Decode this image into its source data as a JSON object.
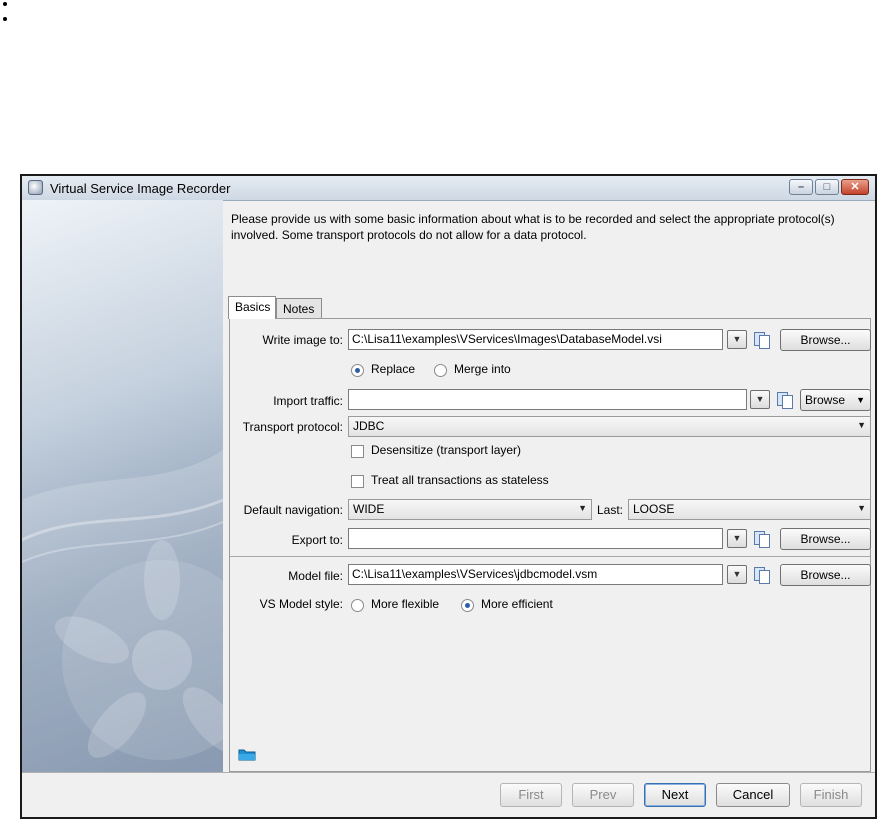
{
  "window": {
    "title": "Virtual Service Image Recorder"
  },
  "instructions": "Please provide us with some basic information about what is to be recorded and select the appropriate protocol(s) involved.  Some transport protocols do not allow for a data protocol.",
  "tabs": [
    {
      "label": "Basics",
      "active": true
    },
    {
      "label": "Notes",
      "active": false
    }
  ],
  "form": {
    "write_image": {
      "label": "Write image to:",
      "value": "C:\\Lisa11\\examples\\VServices\\Images\\DatabaseModel.vsi",
      "browse": "Browse..."
    },
    "write_mode": {
      "replace": "Replace",
      "merge": "Merge into",
      "selected": "Replace"
    },
    "import_traffic": {
      "label": "Import traffic:",
      "value": "",
      "browse": "Browse"
    },
    "transport": {
      "label": "Transport protocol:",
      "value": "JDBC"
    },
    "desensitize": {
      "label": "Desensitize (transport layer)",
      "checked": false
    },
    "stateless": {
      "label": "Treat all transactions as stateless",
      "checked": false
    },
    "navigation": {
      "label": "Default navigation:",
      "value": "WIDE",
      "last_label": "Last:",
      "last_value": "LOOSE"
    },
    "export_to": {
      "label": "Export to:",
      "value": "",
      "browse": "Browse..."
    },
    "model_file": {
      "label": "Model file:",
      "value": "C:\\Lisa11\\examples\\VServices\\jdbcmodel.vsm",
      "browse": "Browse..."
    },
    "model_style": {
      "label": "VS Model style:",
      "flexible": "More flexible",
      "efficient": "More efficient",
      "selected": "More efficient"
    }
  },
  "footer": {
    "first": "First",
    "prev": "Prev",
    "next": "Next",
    "cancel": "Cancel",
    "finish": "Finish"
  },
  "colors": {
    "accent": "#2b5fa8",
    "close_button": "#c4432b"
  }
}
